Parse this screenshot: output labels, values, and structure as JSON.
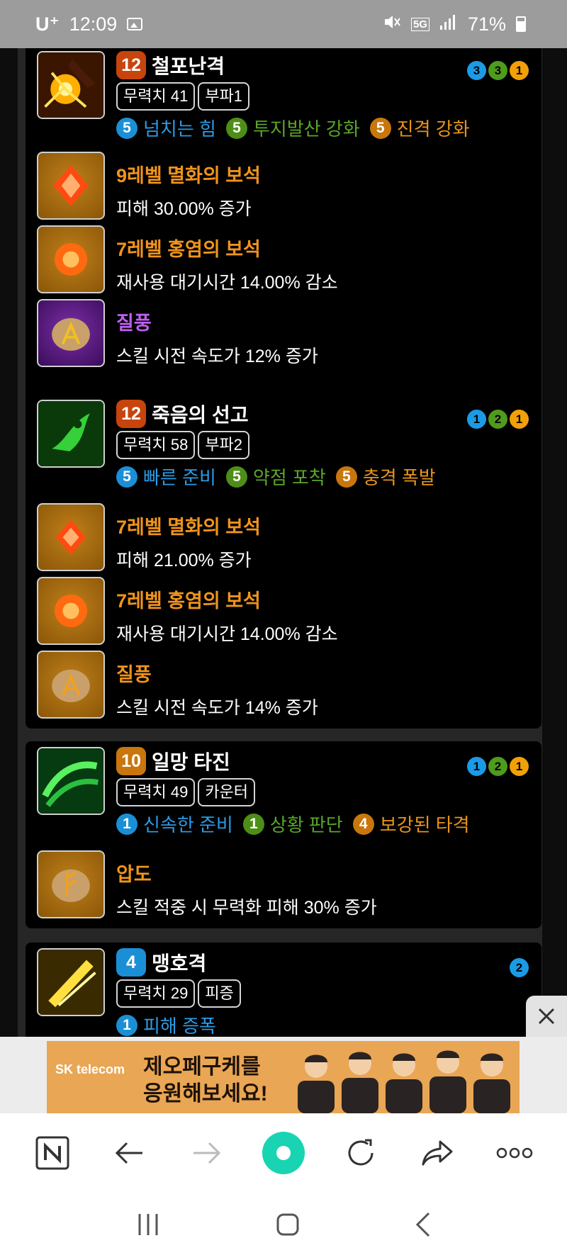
{
  "status_bar": {
    "carrier": "U⁺",
    "time": "12:09",
    "network": "5G",
    "battery": "71%"
  },
  "cards": [
    {
      "skill": {
        "level": "12",
        "name": "철포난격",
        "tags": [
          "무력치 41",
          "부파1"
        ],
        "dots": [
          "3",
          "3",
          "1"
        ],
        "tripods": [
          {
            "level": "5",
            "name": "넘치는 힘",
            "color": "blue"
          },
          {
            "level": "5",
            "name": "투지발산 강화",
            "color": "green"
          },
          {
            "level": "5",
            "name": "진격 강화",
            "color": "orange"
          }
        ]
      },
      "gems": [
        {
          "title": "9레벨 멸화의 보석",
          "desc": "피해 30.00% 증가"
        },
        {
          "title": "7레벨 홍염의 보석",
          "desc": "재사용 대기시간 14.00% 감소"
        }
      ],
      "rune": {
        "title": "질풍",
        "desc": "스킬 시전 속도가 12% 증가"
      }
    },
    {
      "skill": {
        "level": "12",
        "name": "죽음의 선고",
        "tags": [
          "무력치 58",
          "부파2"
        ],
        "dots": [
          "1",
          "2",
          "1"
        ],
        "tripods": [
          {
            "level": "5",
            "name": "빠른 준비",
            "color": "blue"
          },
          {
            "level": "5",
            "name": "약점 포착",
            "color": "green"
          },
          {
            "level": "5",
            "name": "충격 폭발",
            "color": "orange"
          }
        ]
      },
      "gems": [
        {
          "title": "7레벨 멸화의 보석",
          "desc": "피해 21.00% 증가"
        },
        {
          "title": "7레벨 홍염의 보석",
          "desc": "재사용 대기시간 14.00% 감소"
        }
      ],
      "rune": {
        "title": "질풍",
        "desc": "스킬 시전 속도가 14% 증가"
      }
    },
    {
      "skill": {
        "level": "10",
        "name": "일망 타진",
        "tags": [
          "무력치 49",
          "카운터"
        ],
        "dots": [
          "1",
          "2",
          "1"
        ],
        "tripods": [
          {
            "level": "1",
            "name": "신속한 준비",
            "color": "blue"
          },
          {
            "level": "1",
            "name": "상황 판단",
            "color": "green"
          },
          {
            "level": "4",
            "name": "보강된 타격",
            "color": "orange"
          }
        ]
      },
      "rune": {
        "title": "압도",
        "desc": "스킬 적중 시 무력화 피해 30% 증가"
      }
    },
    {
      "skill": {
        "level": "4",
        "name": "맹호격",
        "tags": [
          "무력치 29",
          "피증"
        ],
        "dots": [
          "2"
        ],
        "tripods": [
          {
            "level": "1",
            "name": "피해 증폭",
            "color": "blue"
          }
        ]
      }
    }
  ],
  "ad": {
    "logo": "SK telecom",
    "line1": "제오페구케를",
    "line2": "응원해보세요!"
  },
  "toolbar": {
    "icons": [
      "naver-home-icon",
      "back-icon",
      "forward-icon",
      "green-dot-icon",
      "reload-icon",
      "share-icon",
      "more-icon"
    ]
  },
  "colors": {
    "accent_orange": "#f0941c",
    "tripod_blue": "#2b9be6",
    "tripod_green": "#5aa62a",
    "rune_purple": "#c060f0",
    "naver_green": "#19d4b2"
  }
}
